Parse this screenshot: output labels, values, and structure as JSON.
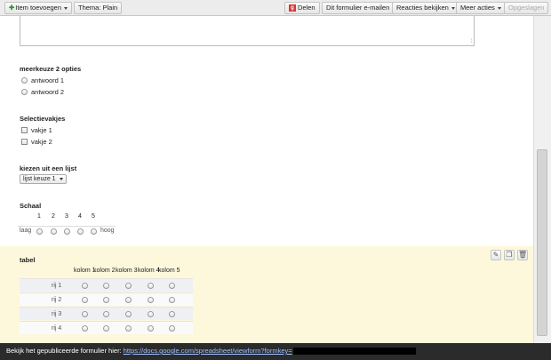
{
  "toolbar": {
    "add_item": "Item toevoegen",
    "theme": "Thema:  Plain",
    "share": "Delen",
    "email_form": "Dit formulier e-mailen",
    "view_responses": "Reacties bekijken",
    "more_actions": "Meer acties",
    "saved": "Opgeslagen"
  },
  "questions": {
    "q_multiple": {
      "title": "meerkeuze 2 opties",
      "options": [
        "antwoord 1",
        "antwoord 2"
      ]
    },
    "q_checkbox": {
      "title": "Selectievakjes",
      "options": [
        "vakje 1",
        "vakje 2"
      ]
    },
    "q_list": {
      "title": "kiezen uit een lijst",
      "selected": "lijst keuze 1"
    },
    "q_scale": {
      "title": "Schaal",
      "numbers": [
        "1",
        "2",
        "3",
        "4",
        "5"
      ],
      "low_label": "laag",
      "high_label": "hoog"
    },
    "q_grid": {
      "title": "tabel",
      "columns": [
        "kolom 1",
        "kolom 2",
        "kolom 3",
        "kolom 4",
        "kolom 5"
      ],
      "rows": [
        "rij 1",
        "rij 2",
        "rij 3",
        "rij 4"
      ]
    }
  },
  "footer": {
    "text": "Bekijk het gepubliceerde formulier hier:",
    "link": "https://docs.google.com/spreadsheet/viewform?formkey="
  },
  "colors": {
    "highlight": "#fdf8dc",
    "footer_bg": "#2b2b2b",
    "link": "#9fc0ff"
  }
}
